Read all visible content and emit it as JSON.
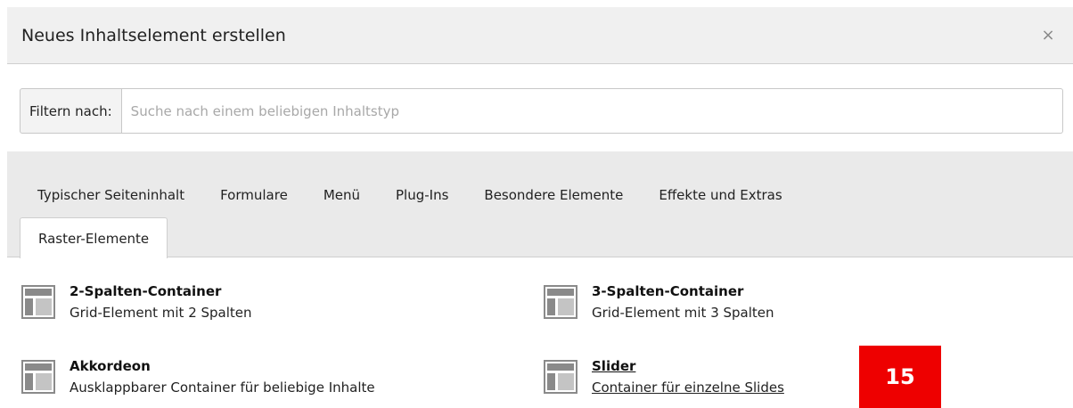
{
  "dialog": {
    "title": "Neues Inhaltselement erstellen",
    "close_glyph": "×"
  },
  "filter": {
    "label": "Filtern nach:",
    "value": "",
    "placeholder": "Suche nach einem beliebigen Inhaltstyp"
  },
  "tabs": [
    {
      "label": "Typischer Seiteninhalt",
      "active": false
    },
    {
      "label": "Formulare",
      "active": false
    },
    {
      "label": "Menü",
      "active": false
    },
    {
      "label": "Plug-Ins",
      "active": false
    },
    {
      "label": "Besondere Elemente",
      "active": false
    },
    {
      "label": "Effekte und Extras",
      "active": false
    },
    {
      "label": "Raster-Elemente",
      "active": true
    }
  ],
  "items": [
    {
      "title": "2-Spalten-Container",
      "desc": "Grid-Element mit 2 Spalten",
      "icon": "grid-layout-icon"
    },
    {
      "title": "3-Spalten-Container",
      "desc": "Grid-Element mit 3 Spalten",
      "icon": "grid-layout-icon"
    },
    {
      "title": "Akkordeon",
      "desc": "Ausklappbarer Container für beliebige Inhalte",
      "icon": "grid-layout-icon"
    },
    {
      "title": "Slider",
      "desc": "Container für einzelne Slides",
      "icon": "grid-layout-icon",
      "hovered": true
    }
  ],
  "badge": {
    "text": "15",
    "color": "#ee0000"
  }
}
